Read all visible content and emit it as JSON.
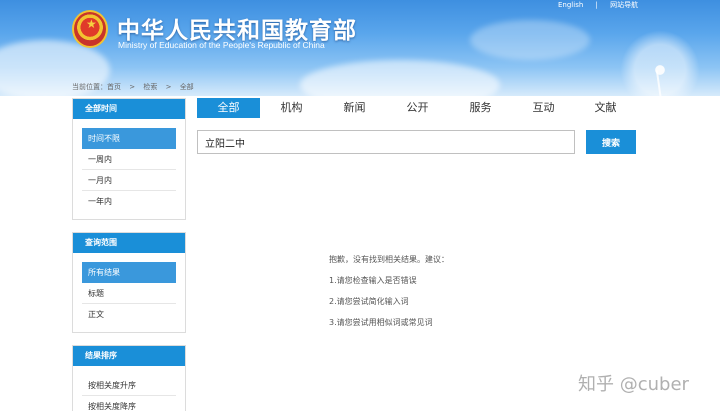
{
  "header": {
    "title": "中华人民共和国教育部",
    "subtitle": "Ministry of Education of the People's Republic of China",
    "top_links": [
      "English",
      "网站导航"
    ]
  },
  "breadcrumb": [
    "当前位置：首页",
    ">",
    "检索",
    ">",
    "全部"
  ],
  "sidebar": {
    "time": {
      "title": "全部时间",
      "items": [
        "时间不限",
        "一周内",
        "一月内",
        "一年内"
      ],
      "active": 0
    },
    "scope": {
      "title": "查询范围",
      "items": [
        "所有结果",
        "标题",
        "正文"
      ],
      "active": 0
    },
    "sort": {
      "title": "结果排序",
      "items": [
        "按相关度升序",
        "按相关度降序"
      ]
    }
  },
  "tabs": [
    "全部",
    "机构",
    "新闻",
    "公开",
    "服务",
    "互动",
    "文献"
  ],
  "search": {
    "value": "立阳二中",
    "button": "搜索"
  },
  "results": {
    "message": "抱歉，没有找到相关结果。建议：",
    "suggestions": [
      "1.请您检查输入是否错误",
      "2.请您尝试简化输入词",
      "3.请您尝试用相似词或常见词"
    ]
  },
  "watermark": "知乎 @cuber",
  "colors": {
    "accent": "#1a8fd8",
    "header": "#5aa6ec"
  }
}
